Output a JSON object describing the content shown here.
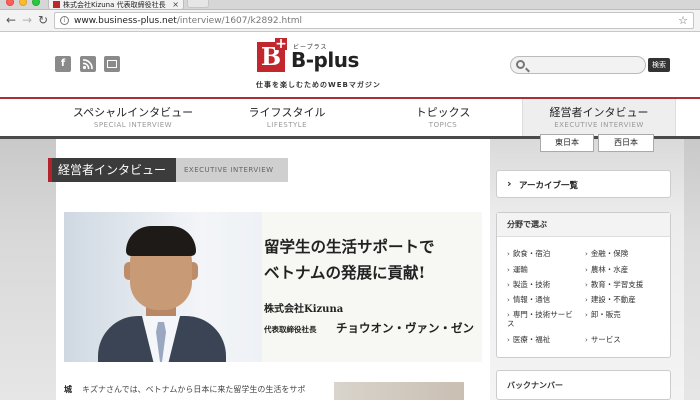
{
  "browser": {
    "tab_title": "株式会社Kizuna 代表取締役社長",
    "url_host": "www.business-plus.net",
    "url_path": "/interview/1607/k2892.html"
  },
  "header": {
    "logo_letter": "B",
    "logo_plus": "+",
    "logo_ruby": "ビープラス",
    "logo_word": "B-plus",
    "tagline": "仕事を楽しむためのWEBマガジン",
    "search_button": "検索",
    "social_icons": [
      "facebook-icon",
      "rss-icon",
      "mail-icon"
    ]
  },
  "nav": {
    "items": [
      {
        "jp": "スペシャルインタビュー",
        "en": "SPECIAL INTERVIEW"
      },
      {
        "jp": "ライフスタイル",
        "en": "LIFESTYLE"
      },
      {
        "jp": "トピックス",
        "en": "TOPICS"
      },
      {
        "jp": "経営者インタビュー",
        "en": "EXECUTIVE INTERVIEW"
      }
    ],
    "subtabs": [
      "東日本",
      "西日本"
    ]
  },
  "section": {
    "title": "経営者インタビュー",
    "subtitle": "EXECUTIVE INTERVIEW"
  },
  "hero": {
    "headline_line1": "留学生の生活サポートで",
    "headline_line2": "ベトナムの発展に貢献!",
    "company": "株式会社Kizuna",
    "role": "代表取締役社長",
    "name": "チョウオン・ヴァン・ゼン"
  },
  "article": {
    "initial": "城",
    "lead": "キズナさんでは、ベトナムから日本に来た留学生の生活をサポ"
  },
  "sidebar": {
    "archive_label": "アーカイブ一覧",
    "category_title": "分野で選ぶ",
    "categories_left": [
      "飲食・宿泊",
      "運輸",
      "製造・技術",
      "情報・通信",
      "専門・技術サービ",
      "医療・福祉"
    ],
    "categories_right": [
      "金融・保険",
      "農林・水産",
      "教育・学習支援",
      "建設・不動産",
      "卸・販売",
      "サービス"
    ],
    "category_overflow": "ス",
    "backnumber_label": "バックナンバー"
  },
  "colors": {
    "brand_red": "#c1272d",
    "nav_dark": "#3c3c3c"
  }
}
